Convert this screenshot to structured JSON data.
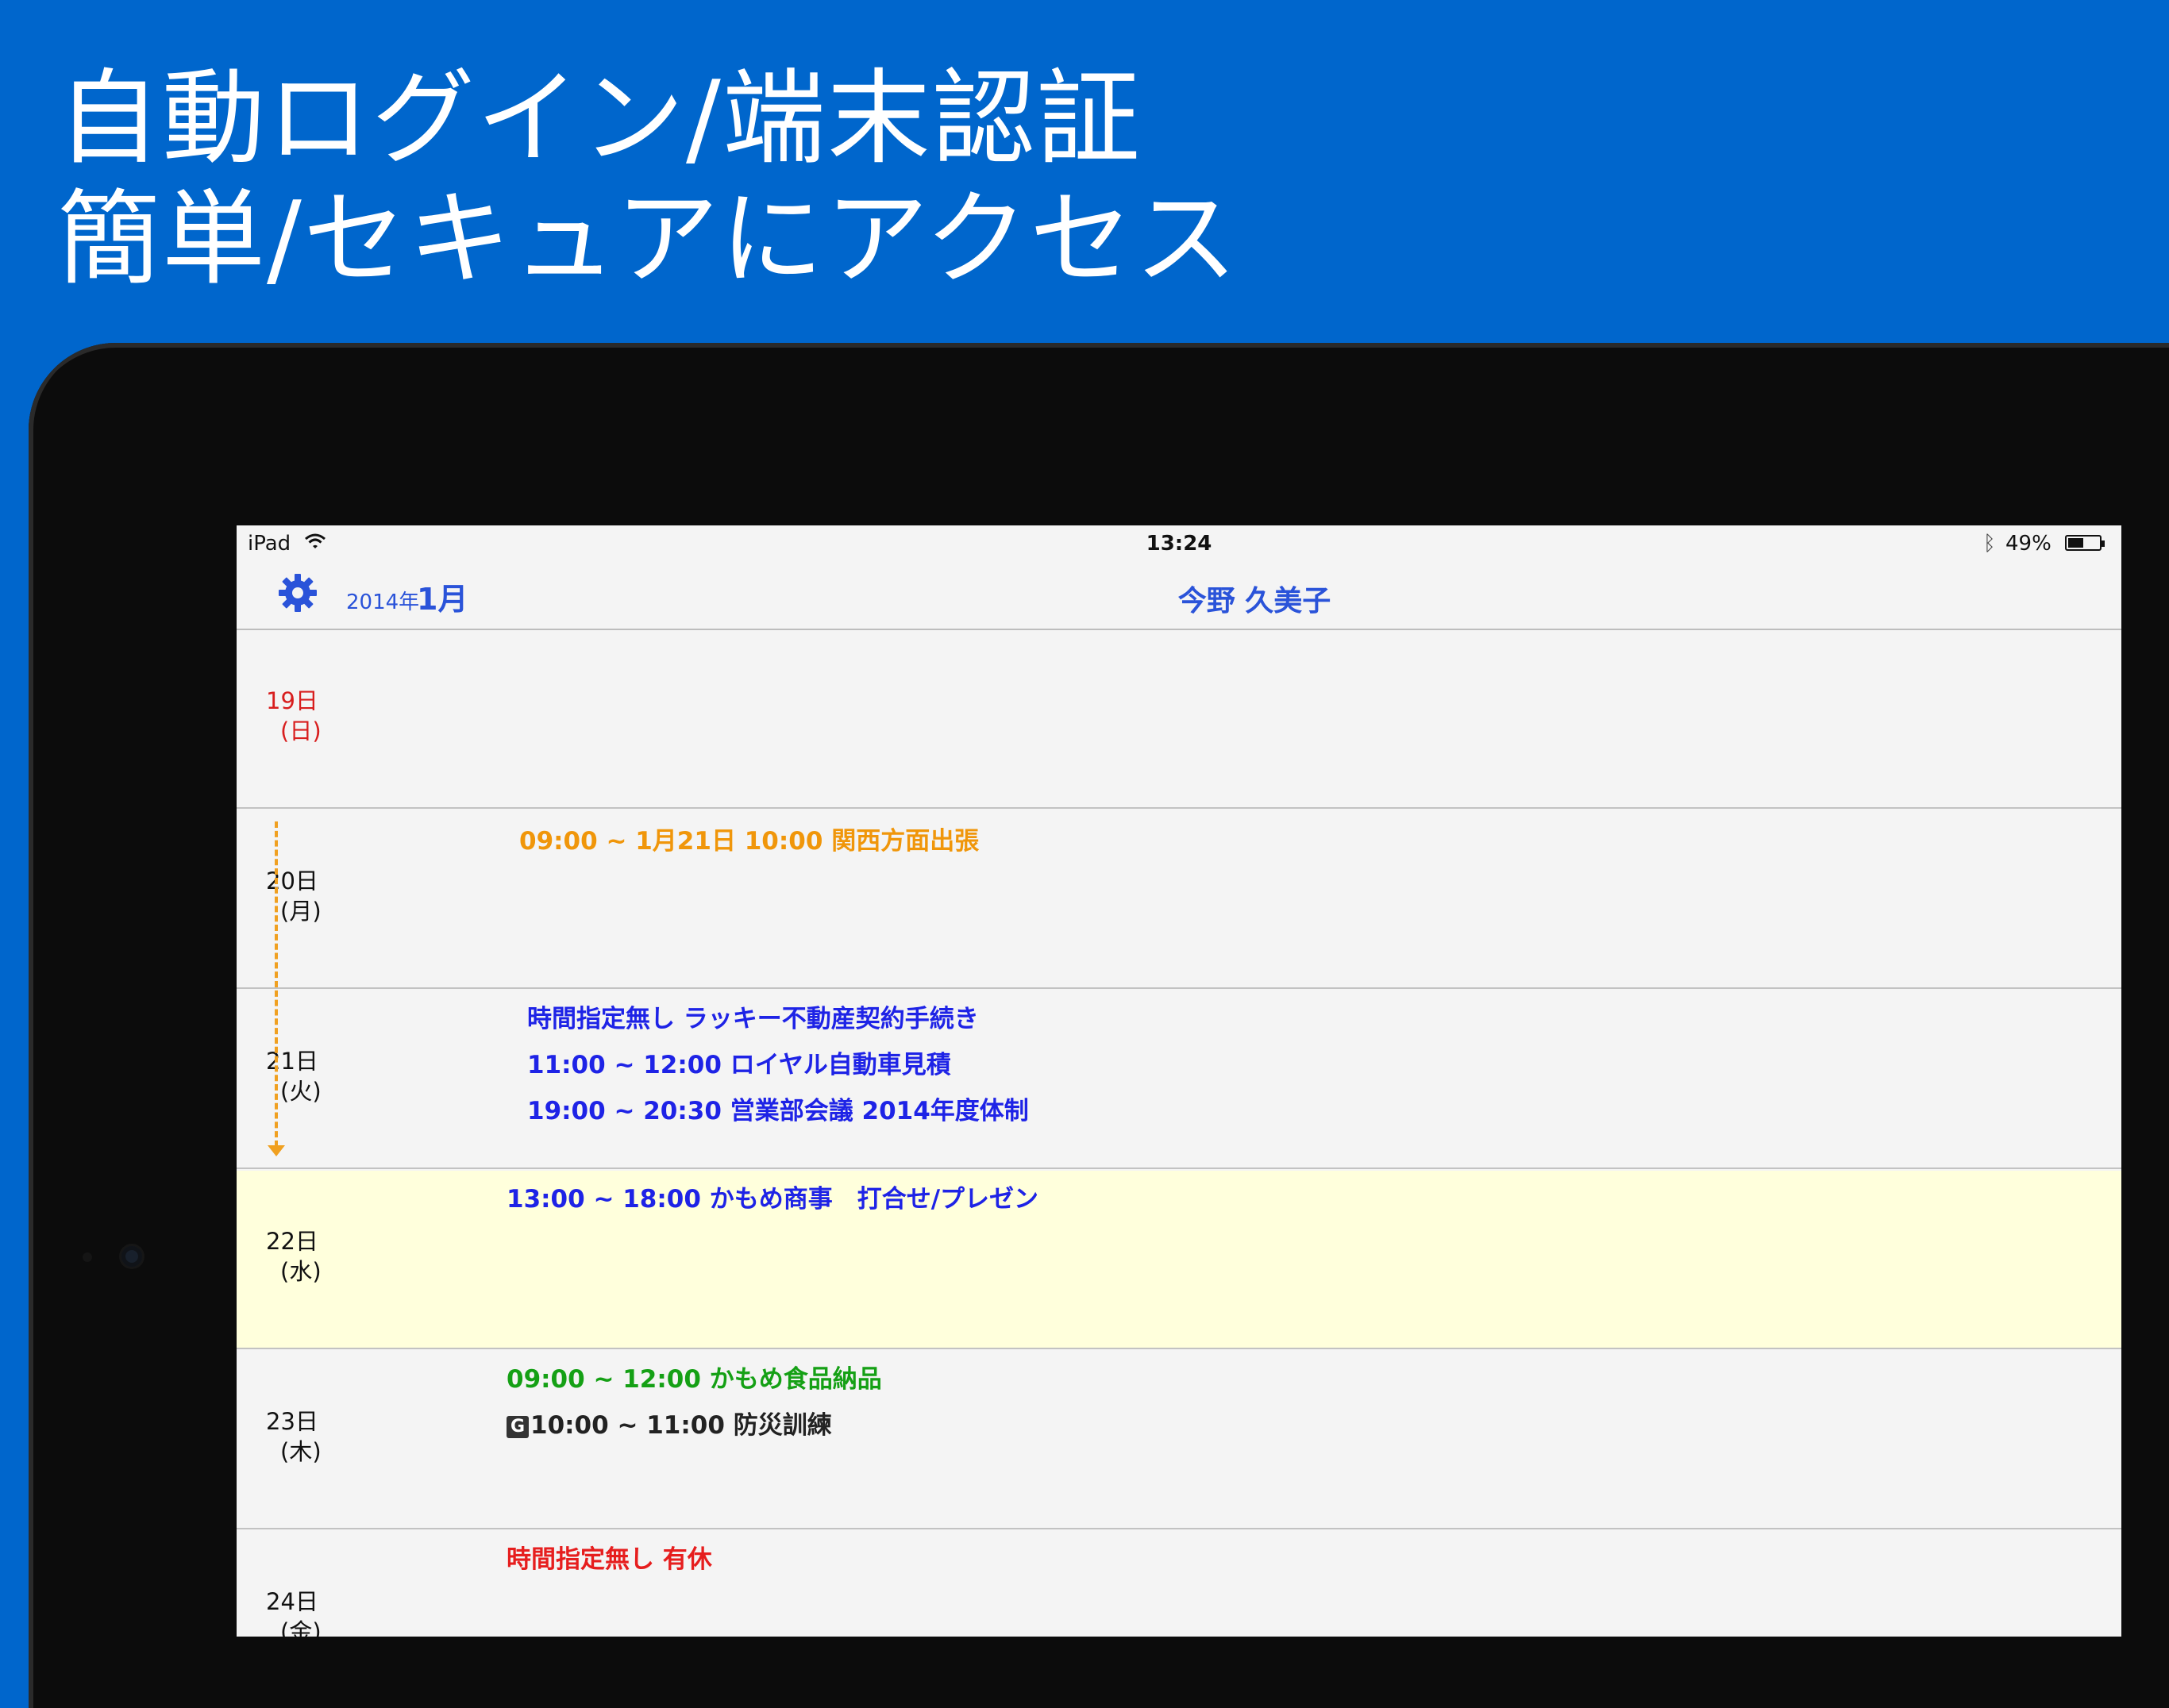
{
  "promo": {
    "line1": "自動ログイン/端末認証",
    "line2": "簡単/セキュアにアクセス"
  },
  "statusbar": {
    "device": "iPad",
    "time": "13:24",
    "battery": "49%",
    "battery_level": 0.49
  },
  "navbar": {
    "year": "2014年",
    "month": "1月",
    "user_name": "今野 久美子"
  },
  "days": [
    {
      "date": "19日",
      "weekday": "(日)"
    },
    {
      "date": "20日",
      "weekday": "(月)"
    },
    {
      "date": "21日",
      "weekday": "(火)"
    },
    {
      "date": "22日",
      "weekday": "(水)"
    },
    {
      "date": "23日",
      "weekday": "(木)"
    },
    {
      "date": "24日",
      "weekday": "(金)"
    }
  ],
  "events": {
    "d20_multi": "09:00 ~ 1月21日 10:00 関西方面出張",
    "d21_1": "時間指定無し ラッキー不動産契約手続き",
    "d21_2": "11:00 ~ 12:00 ロイヤル自動車見積",
    "d21_3": "19:00 ~ 20:30 営業部会議 2014年度体制",
    "d22_1": "13:00 ~ 18:00 かもめ商事　打合せ/プレゼン",
    "d23_1": "09:00 ~ 12:00 かもめ食品納品",
    "d23_2_badge": "G",
    "d23_2": "10:00 ~ 11:00 防災訓練",
    "d24_1": "時間指定無し 有休"
  },
  "colors": {
    "background": "#0066cc",
    "nav_accent": "#2a53d9",
    "sunday": "#d81e1e",
    "today_row": "#ffffdc",
    "multi_day_event": "#f0960a",
    "event_blue": "#1e23e6",
    "event_green": "#15a015",
    "event_red": "#e61e1e"
  },
  "icons": {
    "wifi": "wifi-icon",
    "bluetooth": "bluetooth-icon",
    "battery": "battery-icon",
    "settings": "gear-icon"
  }
}
